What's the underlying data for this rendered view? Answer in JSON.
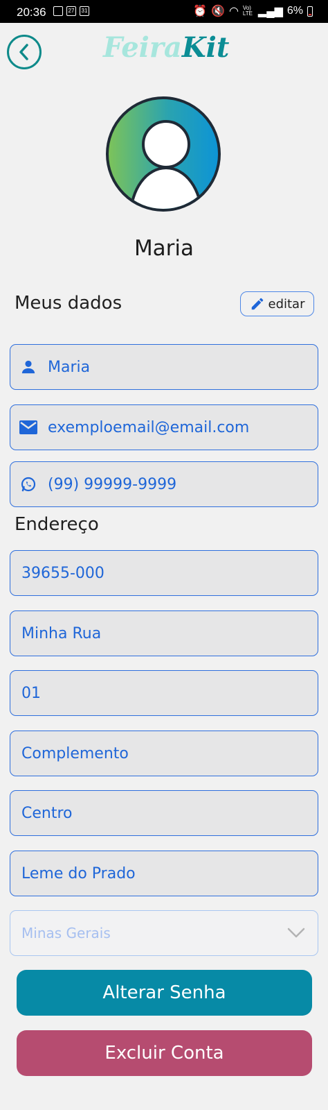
{
  "status_bar": {
    "time": "20:36",
    "battery": "6%",
    "network": "Vo) LTE"
  },
  "header": {
    "logo_part1": "Feira",
    "logo_part2": "Kit",
    "back_icon": "chevron-left-icon"
  },
  "profile": {
    "name": "Maria"
  },
  "my_data": {
    "title": "Meus dados",
    "edit_label": "editar",
    "name": "Maria",
    "email": "exemploemail@email.com",
    "phone": "(99) 99999-9999"
  },
  "address": {
    "title": "Endereço",
    "cep": "39655-000",
    "street": "Minha Rua",
    "number": "01",
    "complement": "Complemento",
    "neighborhood": "Centro",
    "city": "Leme do Prado",
    "state": "Minas Gerais"
  },
  "actions": {
    "change_password": "Alterar Senha",
    "delete_account": "Excluir Conta"
  },
  "colors": {
    "accent": "#2f6fdd",
    "primary_button": "#078aa6",
    "danger_button": "#b64c70",
    "logo_light": "#a7e6dd",
    "logo_dark": "#0b8d95"
  }
}
